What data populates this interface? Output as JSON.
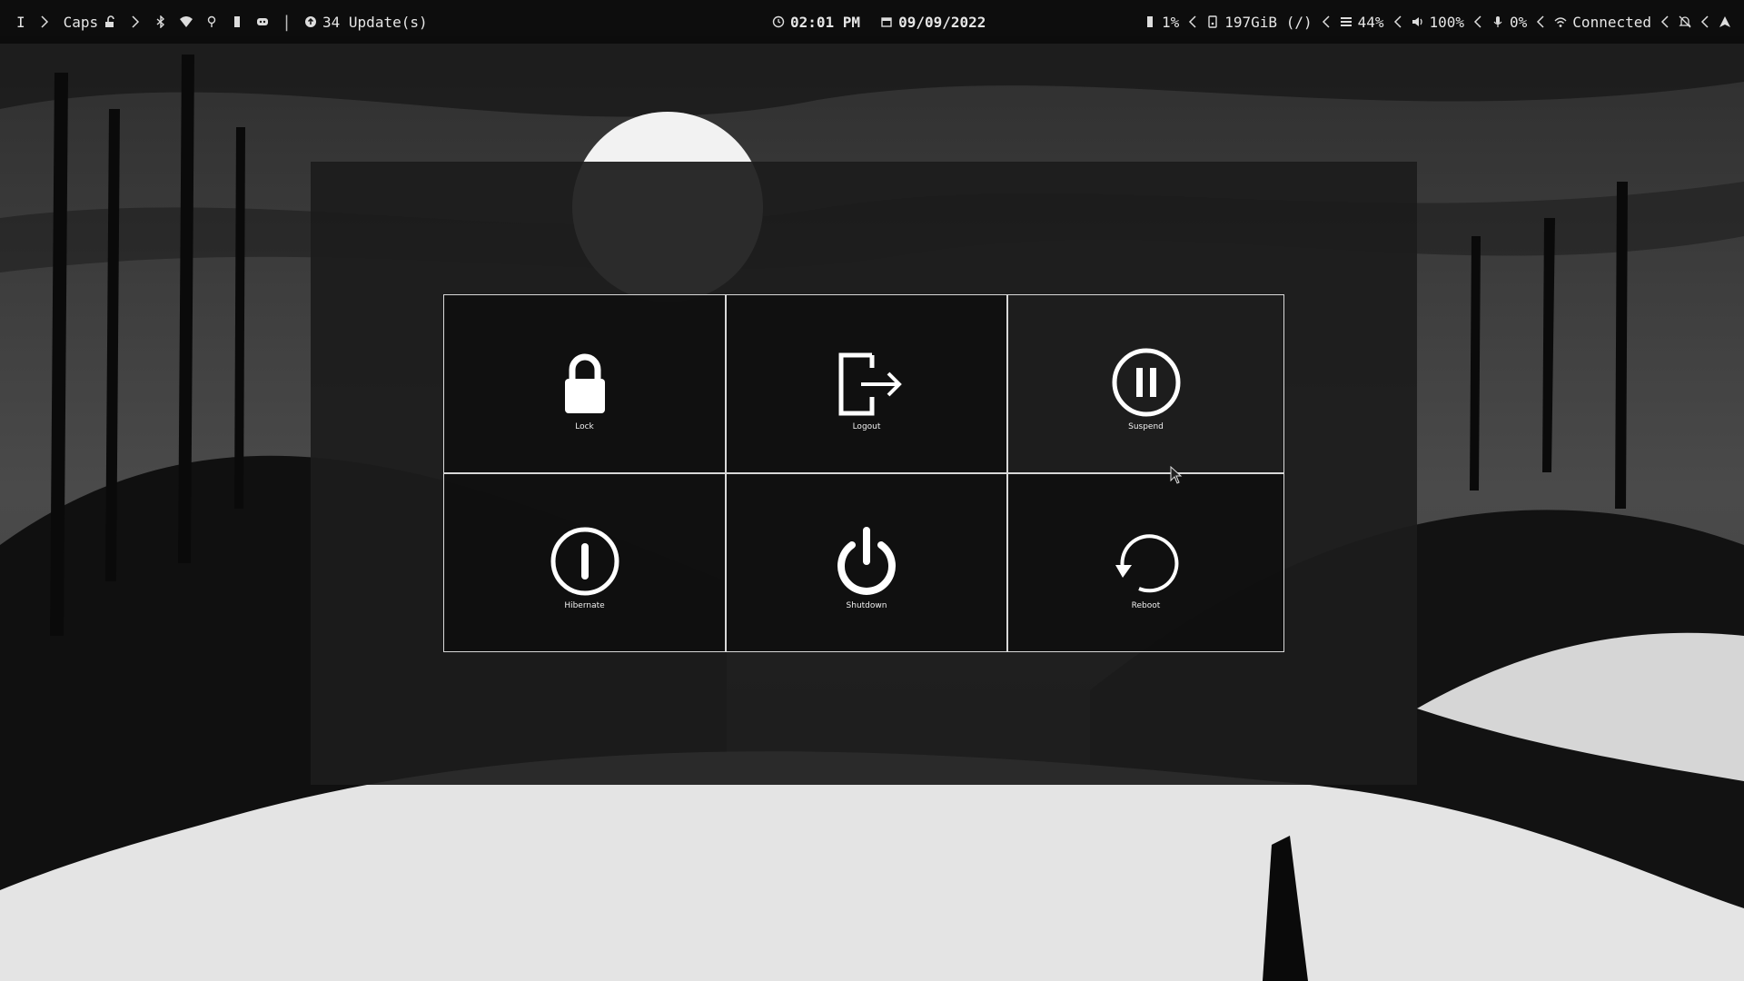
{
  "topbar": {
    "left": {
      "workspace": "I",
      "caps_label": "Caps",
      "updates": "34 Update(s)",
      "icons": [
        "chevron-right-icon",
        "unlock-icon",
        "bluetooth-icon",
        "wifi-icon",
        "location-icon",
        "battery-icon",
        "discord-icon",
        "upload-circle-icon"
      ]
    },
    "center": {
      "time": "02:01 PM",
      "date": "09/09/2022"
    },
    "right": {
      "battery": "1%",
      "disk": "197GiB (/)",
      "memory": "44%",
      "volume": "100%",
      "mic": "0%",
      "network": "Connected"
    }
  },
  "power_menu": {
    "options": [
      {
        "label": "Lock",
        "icon": "lock-icon"
      },
      {
        "label": "Logout",
        "icon": "logout-icon"
      },
      {
        "label": "Suspend",
        "icon": "pause-circle-icon"
      },
      {
        "label": "Hibernate",
        "icon": "hibernate-icon"
      },
      {
        "label": "Shutdown",
        "icon": "power-icon"
      },
      {
        "label": "Reboot",
        "icon": "reboot-icon"
      }
    ]
  },
  "colors": {
    "bar_bg": "#0c0c0c",
    "tile_border": "#d8d8d8",
    "panel_bg": "#1c1c1c",
    "text": "#e8e8e8"
  }
}
